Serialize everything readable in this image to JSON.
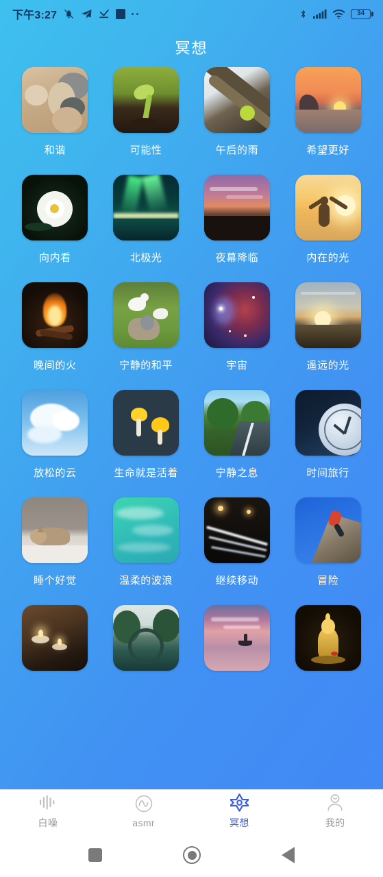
{
  "status_bar": {
    "time": "下午3:27",
    "left_icons": [
      "bell-muted-icon",
      "send-arrow-icon",
      "download-check-icon",
      "square-filled-icon",
      "more-dots-icon"
    ],
    "right_icons": [
      "bluetooth-icon",
      "cellular-signal-icon",
      "wifi-icon",
      "battery-icon"
    ],
    "battery_level": "34"
  },
  "header": {
    "title": "冥想"
  },
  "grid": {
    "items": [
      {
        "label": "和谐",
        "art": "a-stones",
        "parts": 5
      },
      {
        "label": "可能性",
        "art": "a-sprout",
        "parts": 3
      },
      {
        "label": "午后的雨",
        "art": "a-rain",
        "parts": 3
      },
      {
        "label": "希望更好",
        "art": "a-sunsetA",
        "parts": 3
      },
      {
        "label": "向内看",
        "art": "a-lotus",
        "parts": 4
      },
      {
        "label": "北极光",
        "art": "a-aurora",
        "parts": 4
      },
      {
        "label": "夜幕降临",
        "art": "a-dusk",
        "parts": 3
      },
      {
        "label": "内在的光",
        "art": "a-innerlight",
        "parts": 5
      },
      {
        "label": "晚间的火",
        "art": "a-fire",
        "parts": 4
      },
      {
        "label": "宁静的和平",
        "art": "a-doves",
        "parts": 5
      },
      {
        "label": "宇宙",
        "art": "a-cosmos",
        "parts": 5
      },
      {
        "label": "遥远的光",
        "art": "a-farlight",
        "parts": 3
      },
      {
        "label": "放松的云",
        "art": "a-clouds",
        "parts": 3
      },
      {
        "label": "生命就是活着",
        "art": "a-mushroom",
        "parts": 4
      },
      {
        "label": "宁静之息",
        "art": "a-road",
        "parts": 4
      },
      {
        "label": "时间旅行",
        "art": "a-clock",
        "parts": 4
      },
      {
        "label": "睡个好觉",
        "art": "a-cat",
        "parts": 4
      },
      {
        "label": "温柔的波浪",
        "art": "a-waves",
        "parts": 3
      },
      {
        "label": "继续移动",
        "art": "a-traffic",
        "parts": 5
      },
      {
        "label": "冒险",
        "art": "a-climb",
        "parts": 3
      },
      {
        "label": "",
        "art": "a-candles",
        "parts": 4
      },
      {
        "label": "",
        "art": "a-bridge",
        "parts": 3
      },
      {
        "label": "",
        "art": "a-boat",
        "parts": 4
      },
      {
        "label": "",
        "art": "a-buddha",
        "parts": 5
      }
    ]
  },
  "tabbar": {
    "active_color": "#3B5FE0",
    "inactive_color": "#9a9a9a",
    "tabs": [
      {
        "label": "白噪",
        "icon": "waveform-icon",
        "active": false
      },
      {
        "label": "asmr",
        "icon": "sine-circle-icon",
        "active": false
      },
      {
        "label": "冥想",
        "icon": "star-flower-icon",
        "active": true
      },
      {
        "label": "我的",
        "icon": "person-icon",
        "active": false
      }
    ]
  },
  "android_nav": {
    "buttons": [
      {
        "name": "recents-button",
        "icon": "square-icon"
      },
      {
        "name": "home-button",
        "icon": "circle-icon"
      },
      {
        "name": "back-button",
        "icon": "triangle-left-icon"
      }
    ]
  }
}
